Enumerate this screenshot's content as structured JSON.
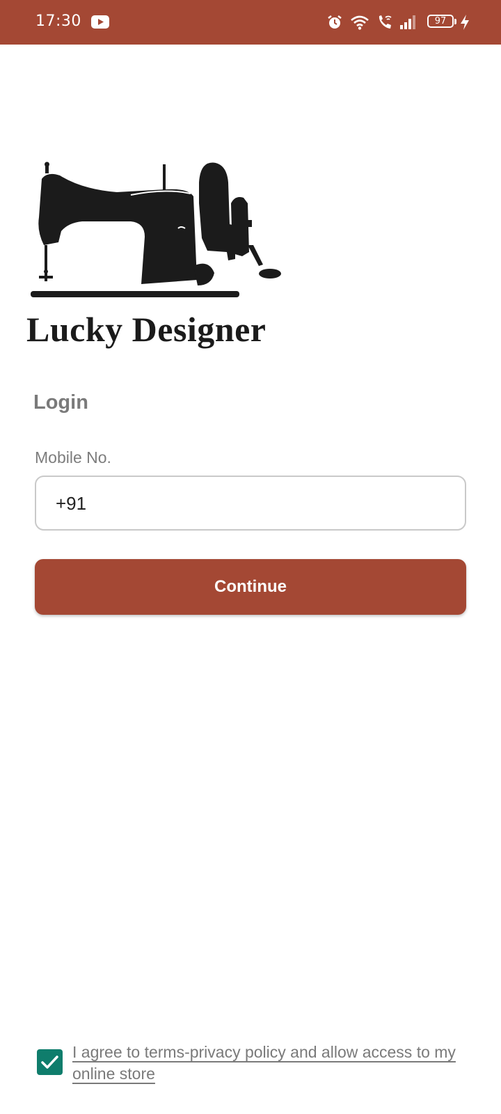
{
  "status_bar": {
    "time": "17:30",
    "battery_level": "97",
    "icons": [
      "youtube-icon",
      "alarm-icon",
      "wifi-icon",
      "wifi-call-icon",
      "signal-icon",
      "battery-icon",
      "charging-bolt-icon"
    ],
    "background_color": "#A44834"
  },
  "logo": {
    "brand_name": "Lucky Designer",
    "image": "sewing-machine-logo"
  },
  "login": {
    "title": "Login",
    "mobile_label": "Mobile No.",
    "mobile_value": "+91",
    "continue_label": "Continue",
    "accent_color": "#A44834"
  },
  "terms": {
    "checked": true,
    "text": "I agree to terms-privacy policy and allow access to my online store",
    "checkbox_color": "#0F7D6C"
  }
}
